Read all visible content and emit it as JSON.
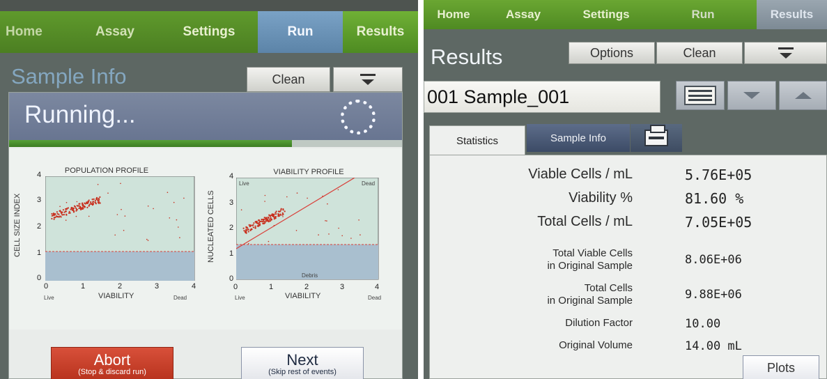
{
  "left": {
    "nav": [
      "Home",
      "Assay",
      "Settings",
      "Run",
      "Results"
    ],
    "title": "Sample Info",
    "clean_label": "Clean",
    "status": "Running...",
    "progress": 0.72,
    "population_plot": {
      "title": "POPULATION PROFILE",
      "ylabel": "CELL SIZE INDEX",
      "xlabel": "VIABILITY",
      "xticks": [
        "0",
        "1",
        "2",
        "3",
        "4"
      ],
      "yticks": [
        "0",
        "1",
        "2",
        "3",
        "4"
      ],
      "x_left": "Live",
      "x_right": "Dead"
    },
    "viability_plot": {
      "title": "VIABILITY PROFILE",
      "ylabel": "NUCLEATED CELLS",
      "xlabel": "VIABILITY",
      "xticks": [
        "0",
        "1",
        "2",
        "3",
        "4"
      ],
      "yticks": [
        "0",
        "1",
        "2",
        "3",
        "4"
      ],
      "x_left": "Live",
      "x_right": "Dead",
      "corner_live": "Live",
      "corner_dead": "Dead",
      "debris": "Debris"
    },
    "abort": {
      "label": "Abort",
      "sub": "(Stop & discard run)"
    },
    "next": {
      "label": "Next",
      "sub": "(Skip rest of events)"
    }
  },
  "right": {
    "nav": [
      "Home",
      "Assay",
      "Settings",
      "Run",
      "Results"
    ],
    "title": "Results",
    "options_label": "Options",
    "clean_label": "Clean",
    "sample_name": "001 Sample_001",
    "tabs": {
      "statistics": "Statistics",
      "sample_info": "Sample Info"
    },
    "stats": [
      {
        "label": "Viable Cells / mL",
        "value": "5.76E+05"
      },
      {
        "label": "Viability %",
        "value": "81.60 %"
      },
      {
        "label": "Total Cells / mL",
        "value": "7.05E+05"
      },
      {
        "label": "Total Viable Cells\nin Original Sample",
        "value": "8.06E+06"
      },
      {
        "label": "Total Cells\nin Original Sample",
        "value": "9.88E+06"
      },
      {
        "label": "Dilution Factor",
        "value": "10.00"
      },
      {
        "label": "Original Volume",
        "value": "14.00 mL"
      }
    ],
    "plots_label": "Plots"
  },
  "colors": {
    "nav_green": "#5f9a2c",
    "active_blue": "#6c94b8",
    "abort_red": "#c4402a"
  }
}
